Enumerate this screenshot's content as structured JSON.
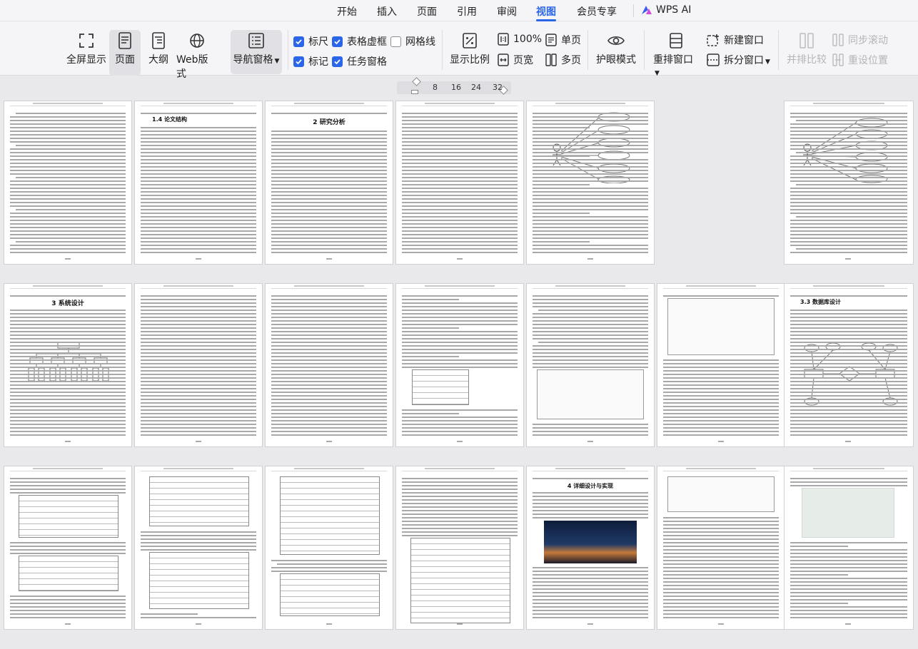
{
  "menu": {
    "items": [
      "开始",
      "插入",
      "页面",
      "引用",
      "审阅",
      "视图",
      "会员专享"
    ],
    "active": "视图",
    "wps_ai": "WPS AI"
  },
  "ribbon": {
    "fullscreen": "全屏显示",
    "page": "页面",
    "outline": "大纲",
    "web": "Web版式",
    "nav_pane": "导航窗格",
    "ruler": "标尺",
    "table_gridlines": "表格虚框",
    "gridlines": "网格线",
    "marks": "标记",
    "task_pane": "任务窗格",
    "zoom": "显示比例",
    "zoom_100": "100%",
    "page_width": "页宽",
    "single_page": "单页",
    "multi_page": "多页",
    "eye_mode": "护眼模式",
    "arrange": "重排窗口",
    "new_window": "新建窗口",
    "split_window": "拆分窗口",
    "side_by_side": "并排比较",
    "sync_scroll": "同步滚动",
    "reset_position": "重设位置"
  },
  "checks": {
    "ruler": true,
    "table_gridlines": true,
    "gridlines": false,
    "marks": true,
    "task_pane": true
  },
  "ruler_labels": [
    "8",
    "16",
    "24",
    "32"
  ],
  "pages": {
    "p2_title": "1.4 论文结构",
    "p3_title": "2 研究分析",
    "p8_title": "3 系统设计",
    "p14_title": "3.3 数据库设计",
    "p18_title": "4 详细设计与实现"
  },
  "colors": {
    "accent": "#2c66e8",
    "checkbox": "#2c66e8"
  }
}
